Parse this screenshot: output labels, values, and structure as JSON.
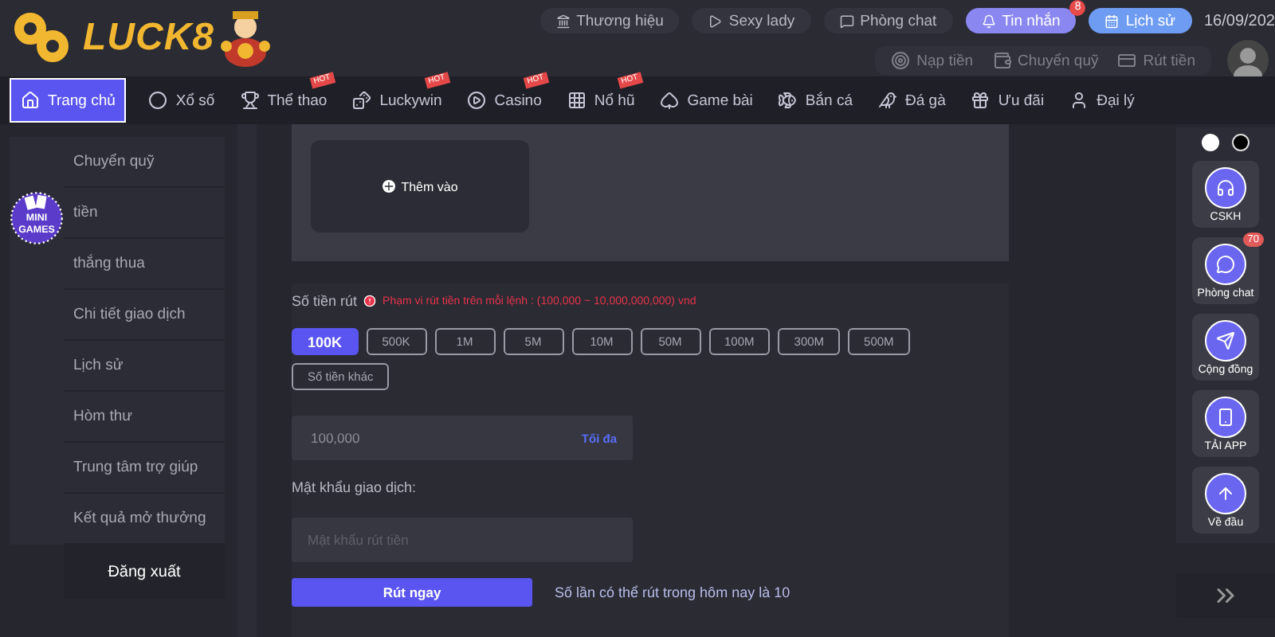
{
  "header": {
    "logo": "LUCK8",
    "top_links": [
      {
        "label": "Thương hiệu",
        "kind": "plain"
      },
      {
        "label": "Sexy lady",
        "kind": "plain"
      },
      {
        "label": "Phòng chat",
        "kind": "plain"
      },
      {
        "label": "Tin nhắn",
        "kind": "accent",
        "badge": "8"
      },
      {
        "label": "Lịch sử",
        "kind": "blue"
      }
    ],
    "date": "16/09/202",
    "wallet_actions": [
      "Nạp tiền",
      "Chuyển quỹ",
      "Rút tiền"
    ]
  },
  "nav": [
    {
      "label": "Trang chủ",
      "selected": true
    },
    {
      "label": "Xổ số",
      "selected": false
    },
    {
      "label": "Thể thao",
      "selected": false,
      "tag": "HOT"
    },
    {
      "label": "Luckywin",
      "selected": false,
      "tag": "HOT"
    },
    {
      "label": "Casino",
      "selected": false,
      "tag": "HOT"
    },
    {
      "label": "Nổ hũ",
      "selected": false,
      "tag": "HOT"
    },
    {
      "label": "Game bài",
      "selected": false
    },
    {
      "label": "Bắn cá",
      "selected": false
    },
    {
      "label": "Đá gà",
      "selected": false
    },
    {
      "label": "Ưu đãi",
      "selected": false
    },
    {
      "label": "Đại lý",
      "selected": false
    }
  ],
  "sidebar": {
    "items": [
      {
        "label": "Chuyển quỹ"
      },
      {
        "label": "tiền"
      },
      {
        "label": "thắng thua"
      },
      {
        "label": "Chi tiết giao dịch"
      },
      {
        "label": "Lịch sử"
      },
      {
        "label": "Hòm thư"
      },
      {
        "label": "Trung tâm trợ giúp"
      },
      {
        "label": "Kết quả mở thưởng"
      }
    ],
    "logout": "Đăng xuất",
    "mini_games": "MINI GAMES"
  },
  "content": {
    "add_button": "Thêm vào",
    "amount_label": "Số tiền rút",
    "range_note": "Phạm vi rút tiền trên mỗi lệnh : (100,000 ~ 10,000,000,000) vnd",
    "chips": [
      {
        "label": "100K",
        "selected": true
      },
      {
        "label": "500K",
        "selected": false
      },
      {
        "label": "1M",
        "selected": false
      },
      {
        "label": "5M",
        "selected": false
      },
      {
        "label": "10M",
        "selected": false
      },
      {
        "label": "50M",
        "selected": false
      },
      {
        "label": "100M",
        "selected": false
      },
      {
        "label": "300M",
        "selected": false
      },
      {
        "label": "500M",
        "selected": false
      },
      {
        "label": "Số tiền khác",
        "selected": false
      }
    ],
    "amount_value": "100,000",
    "max_link": "Tối đa",
    "password_label": "Mật khẩu giao dịch:",
    "password_placeholder": "Mật khẩu rút tiền",
    "submit": "Rút ngay",
    "note": "Số lần có thể rút trong hôm nay là 10"
  },
  "theme_toggle": [
    {
      "selected": true,
      "color": "#ffffff"
    },
    {
      "selected": false,
      "color": "#000000"
    }
  ],
  "float_panel": [
    {
      "label": "CSKH",
      "kind": "support"
    },
    {
      "label": "Phòng chat",
      "kind": "chat",
      "badge": "70"
    },
    {
      "label": "Cộng đồng",
      "kind": "send"
    },
    {
      "label": "TẢI APP",
      "kind": "phone"
    },
    {
      "label": "Về đầu",
      "kind": "up"
    }
  ]
}
